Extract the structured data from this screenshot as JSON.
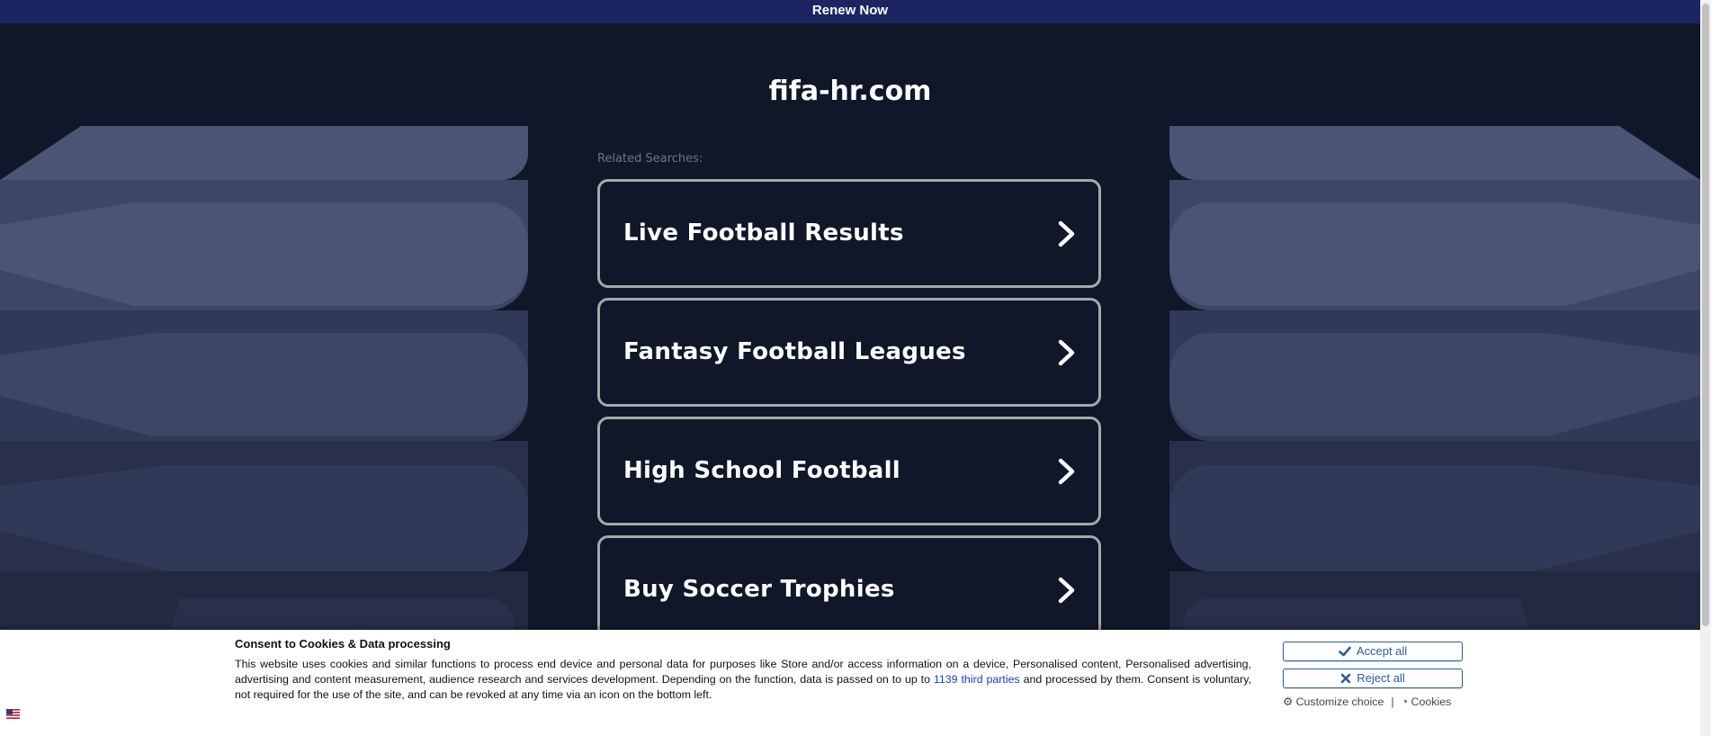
{
  "topbar": {
    "renew_label": "Renew Now"
  },
  "main": {
    "domain": "fifa-hr.com",
    "related_label": "Related Searches:",
    "searches": [
      {
        "label": "Live Football Results",
        "icon": "chevron-right-icon"
      },
      {
        "label": "Fantasy Football Leagues",
        "icon": "chevron-right-icon"
      },
      {
        "label": "High School Football",
        "icon": "chevron-right-icon"
      },
      {
        "label": "Buy Soccer Trophies",
        "icon": "chevron-right-icon"
      }
    ]
  },
  "consent": {
    "title": "Consent to Cookies & Data processing",
    "text_before": "This website uses cookies and similar functions to process end device and personal data for purposes like Store and/or access information on a device, Personalised content, Personalised advertising, advertising and content measurement, audience research and services development. Depending on the function, data is passed on to up to ",
    "third_parties_link": "1139 third parties",
    "text_after": " and processed by them. Consent is voluntary, not required for the use of the site, and can be revoked at any time via an icon on the bottom left.",
    "accept_label": "Accept all",
    "reject_label": "Reject all",
    "customize_label": "Customize choice",
    "separator": "|",
    "cookies_label": "Cookies",
    "icons": {
      "accept": "check-icon",
      "reject": "close-icon",
      "customize": "gear-icon",
      "cookies": "cookie-icon",
      "language": "us-flag-icon"
    }
  },
  "colors": {
    "background": "#101729",
    "topbar": "#1c2461",
    "button_border": "#a8a8a8",
    "consent_button": "#2c5aa0",
    "link": "#1a3bd6"
  }
}
